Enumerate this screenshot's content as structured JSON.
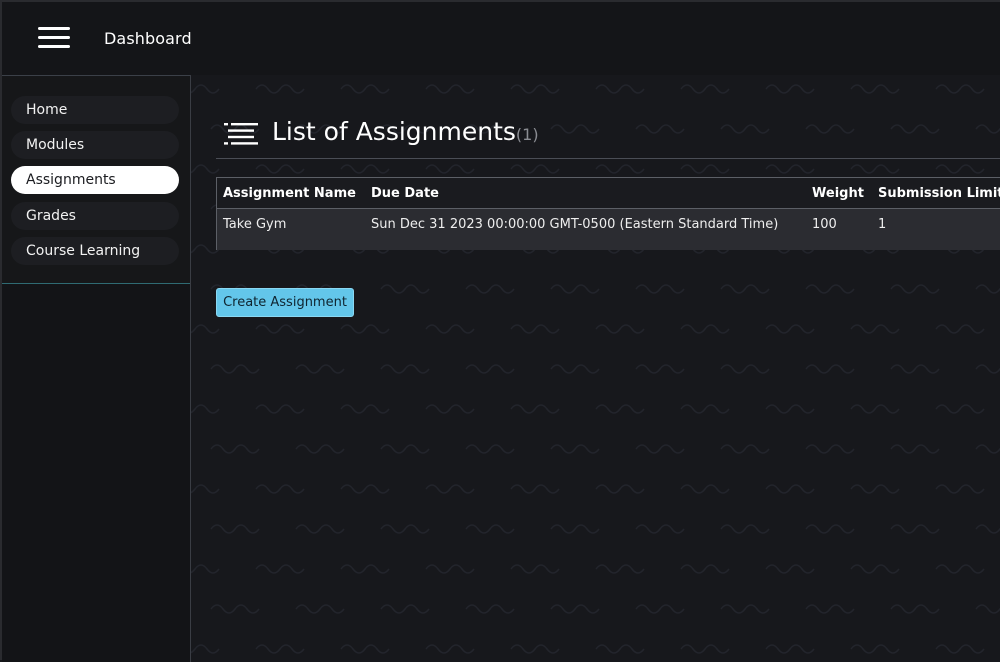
{
  "app": {
    "title": "Dashboard"
  },
  "sidebar": {
    "items": [
      {
        "label": "Home",
        "active": false
      },
      {
        "label": "Modules",
        "active": false
      },
      {
        "label": "Assignments",
        "active": true
      },
      {
        "label": "Grades",
        "active": false
      },
      {
        "label": "Course Learning",
        "active": false
      }
    ]
  },
  "main": {
    "title": "List of Assignments",
    "count": "(1)",
    "table": {
      "columns": [
        "Assignment Name",
        "Due Date",
        "Weight",
        "Submission Limit"
      ],
      "rows": [
        [
          "Take Gym",
          "Sun Dec 31 2023 00:00:00 GMT-0500 (Eastern Standard Time)",
          "100",
          "1"
        ]
      ]
    },
    "create_button": "Create Assignment"
  },
  "icons": {
    "menu": "hamburger-icon",
    "list": "list-icon"
  },
  "colors": {
    "accent": "#63c6ea",
    "background": "#17181c",
    "active_nav": "#ffffff"
  }
}
